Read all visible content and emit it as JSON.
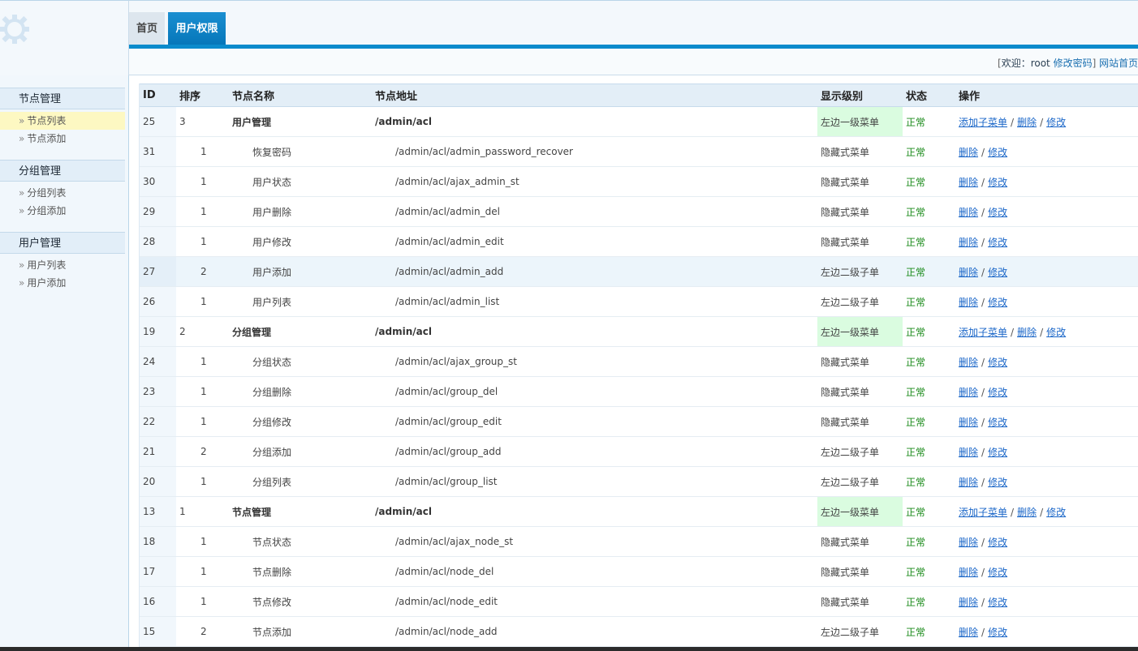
{
  "tabs": {
    "home": "首页",
    "user_perm": "用户权限"
  },
  "welcome": {
    "bracket_open": "[",
    "text": "欢迎：root",
    "change_pwd": "修改密码",
    "bracket_close": "]",
    "site_home": "网站首页"
  },
  "sidebar": [
    {
      "title": "节点管理",
      "items": [
        "节点列表",
        "节点添加"
      ],
      "active": 0
    },
    {
      "title": "分组管理",
      "items": [
        "分组列表",
        "分组添加"
      ],
      "active": -1
    },
    {
      "title": "用户管理",
      "items": [
        "用户列表",
        "用户添加"
      ],
      "active": -1
    }
  ],
  "table": {
    "headers": [
      "ID",
      "排序",
      "节点名称",
      "节点地址",
      "显示级别",
      "状态",
      "操作"
    ],
    "ops": {
      "add_child": "添加子菜单",
      "del": "删除",
      "edit": "修改",
      "sep": "/"
    },
    "rows": [
      {
        "id": "25",
        "sort": "3",
        "name": "用户管理",
        "url": "/admin/acl",
        "level": "左边一级菜单",
        "status": "正常",
        "top": true
      },
      {
        "id": "31",
        "sort": "1",
        "name": "恢复密码",
        "url": "/admin/acl/admin_password_recover",
        "level": "隐藏式菜单",
        "status": "正常"
      },
      {
        "id": "30",
        "sort": "1",
        "name": "用户状态",
        "url": "/admin/acl/ajax_admin_st",
        "level": "隐藏式菜单",
        "status": "正常"
      },
      {
        "id": "29",
        "sort": "1",
        "name": "用户删除",
        "url": "/admin/acl/admin_del",
        "level": "隐藏式菜单",
        "status": "正常"
      },
      {
        "id": "28",
        "sort": "1",
        "name": "用户修改",
        "url": "/admin/acl/admin_edit",
        "level": "隐藏式菜单",
        "status": "正常"
      },
      {
        "id": "27",
        "sort": "2",
        "name": "用户添加",
        "url": "/admin/acl/admin_add",
        "level": "左边二级子单",
        "status": "正常",
        "hover": true
      },
      {
        "id": "26",
        "sort": "1",
        "name": "用户列表",
        "url": "/admin/acl/admin_list",
        "level": "左边二级子单",
        "status": "正常"
      },
      {
        "id": "19",
        "sort": "2",
        "name": "分组管理",
        "url": "/admin/acl",
        "level": "左边一级菜单",
        "status": "正常",
        "top": true
      },
      {
        "id": "24",
        "sort": "1",
        "name": "分组状态",
        "url": "/admin/acl/ajax_group_st",
        "level": "隐藏式菜单",
        "status": "正常"
      },
      {
        "id": "23",
        "sort": "1",
        "name": "分组删除",
        "url": "/admin/acl/group_del",
        "level": "隐藏式菜单",
        "status": "正常"
      },
      {
        "id": "22",
        "sort": "1",
        "name": "分组修改",
        "url": "/admin/acl/group_edit",
        "level": "隐藏式菜单",
        "status": "正常"
      },
      {
        "id": "21",
        "sort": "2",
        "name": "分组添加",
        "url": "/admin/acl/group_add",
        "level": "左边二级子单",
        "status": "正常"
      },
      {
        "id": "20",
        "sort": "1",
        "name": "分组列表",
        "url": "/admin/acl/group_list",
        "level": "左边二级子单",
        "status": "正常"
      },
      {
        "id": "13",
        "sort": "1",
        "name": "节点管理",
        "url": "/admin/acl",
        "level": "左边一级菜单",
        "status": "正常",
        "top": true
      },
      {
        "id": "18",
        "sort": "1",
        "name": "节点状态",
        "url": "/admin/acl/ajax_node_st",
        "level": "隐藏式菜单",
        "status": "正常"
      },
      {
        "id": "17",
        "sort": "1",
        "name": "节点删除",
        "url": "/admin/acl/node_del",
        "level": "隐藏式菜单",
        "status": "正常"
      },
      {
        "id": "16",
        "sort": "1",
        "name": "节点修改",
        "url": "/admin/acl/node_edit",
        "level": "隐藏式菜单",
        "status": "正常"
      },
      {
        "id": "15",
        "sort": "2",
        "name": "节点添加",
        "url": "/admin/acl/node_add",
        "level": "左边二级子单",
        "status": "正常"
      }
    ]
  },
  "colors": {
    "accent": "#0b8bcc",
    "level1_bg": "#dafce0",
    "status_ok": "#1a8a1a",
    "link": "#1a66c8"
  }
}
